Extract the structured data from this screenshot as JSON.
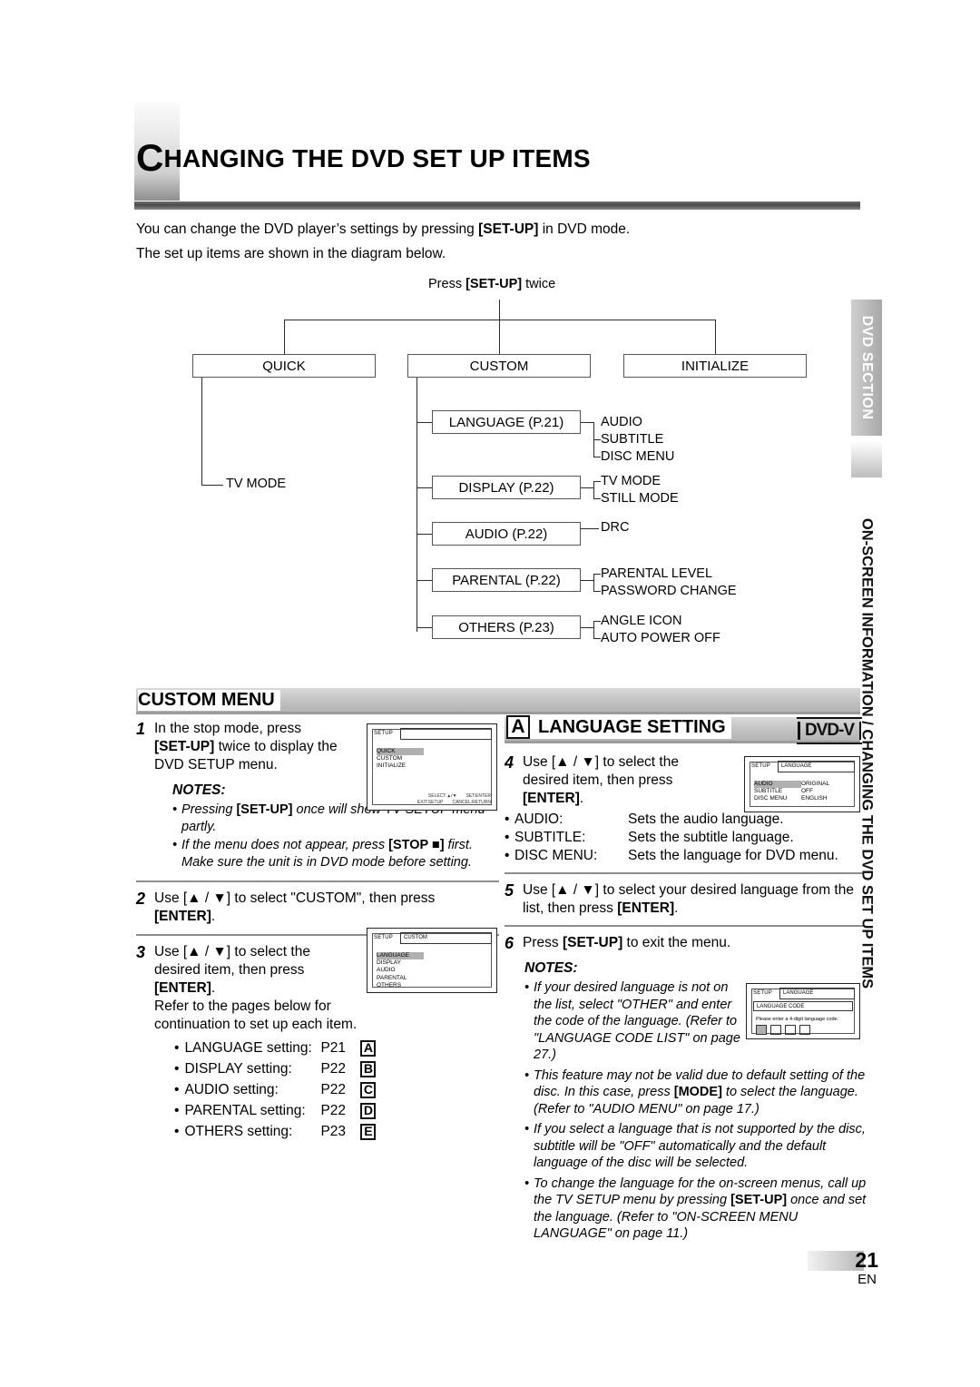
{
  "header": {
    "title_cap": "C",
    "title_rest": "HANGING THE DVD SET UP ITEMS",
    "intro_1_a": "You can change the DVD player’s settings by pressing ",
    "intro_1_b": "[SET-UP]",
    "intro_1_c": " in DVD mode.",
    "intro_2": "The set up items are shown in the diagram below."
  },
  "diagram": {
    "press_label_a": "Press ",
    "press_label_b": "[SET-UP]",
    "press_label_c": " twice",
    "top_boxes": [
      "QUICK",
      "CUSTOM",
      "INITIALIZE"
    ],
    "quick_children": [
      "TV MODE"
    ],
    "custom_boxes": [
      {
        "label": "LANGUAGE (P.21)",
        "children": [
          "AUDIO",
          "SUBTITLE",
          "DISC MENU"
        ]
      },
      {
        "label": "DISPLAY (P.22)",
        "children": [
          "TV MODE",
          "STILL MODE"
        ]
      },
      {
        "label": "AUDIO (P.22)",
        "children": [
          "DRC"
        ]
      },
      {
        "label": "PARENTAL (P.22)",
        "children": [
          "PARENTAL LEVEL",
          "PASSWORD CHANGE"
        ]
      },
      {
        "label": "OTHERS (P.23)",
        "children": [
          "ANGLE ICON",
          "AUTO POWER OFF"
        ]
      }
    ]
  },
  "custom_menu": {
    "heading": "CUSTOM MENU",
    "step1": {
      "num": "1",
      "line1": "In the stop mode, press",
      "bold1": "[SET-UP]",
      "line2": " twice to display the",
      "line3": "DVD SETUP menu.",
      "notes_heading": "NOTES:",
      "note1_a": "Pressing ",
      "note1_b": "[SET-UP]",
      "note1_c": " once will show TV SETUP menu partly.",
      "note2_a": "If the menu does not appear, press ",
      "note2_b": "[STOP ■]",
      "note2_c": " first. Make sure the unit is in DVD mode before setting."
    },
    "step2": {
      "num": "2",
      "text_a": "Use [▲ / ▼] to select \"CUSTOM\", then press ",
      "text_b": "[ENTER]",
      "text_c": "."
    },
    "step3": {
      "num": "3",
      "line1": "Use [▲ / ▼] to select the",
      "line2": "desired item, then press",
      "bold": "[ENTER]",
      "line3": ".",
      "line4": "Refer to the pages below for",
      "line5": "continuation to set up each item.",
      "refer_items": [
        {
          "name": "LANGUAGE setting:",
          "page": "P21",
          "badge": "A"
        },
        {
          "name": "DISPLAY setting:",
          "page": "P22",
          "badge": "B"
        },
        {
          "name": "AUDIO setting:",
          "page": "P22",
          "badge": "C"
        },
        {
          "name": "PARENTAL setting:",
          "page": "P22",
          "badge": "D"
        },
        {
          "name": "OTHERS setting:",
          "page": "P23",
          "badge": "E"
        }
      ]
    },
    "screen_setup": {
      "topbar_label": "SETUP",
      "topbar_value": "",
      "items": [
        "QUICK",
        "CUSTOM",
        "INITIALIZE"
      ],
      "selected": "QUICK",
      "foot_line1_left": "SELECT:▲/▼",
      "foot_line1_right": "SET:ENTER",
      "foot_line2_left": "EXIT:SETUP",
      "foot_line2_right": "CANCEL:RETURN"
    },
    "screen_custom": {
      "topbar_label": "SETUP",
      "topbar_value": "CUSTOM",
      "items": [
        "LANGUAGE",
        "DISPLAY",
        "AUDIO",
        "PARENTAL",
        "OTHERS"
      ],
      "selected": "LANGUAGE"
    }
  },
  "language_setting": {
    "badge": "A",
    "heading": "LANGUAGE SETTING",
    "logo": "DVD-V",
    "step4": {
      "num": "4",
      "line1": "Use [▲ / ▼] to select the",
      "line2": "desired item, then press",
      "bold": "[ENTER]",
      "line3": ".",
      "bullets": [
        {
          "k": "AUDIO:",
          "v": "Sets the audio language."
        },
        {
          "k": "SUBTITLE:",
          "v": "Sets the subtitle language."
        },
        {
          "k": "DISC MENU:",
          "v": "Sets the language for DVD menu."
        }
      ]
    },
    "step5": {
      "num": "5",
      "text_a": "Use [▲ / ▼] to select your desired language from the list, then press ",
      "text_b": "[ENTER]",
      "text_c": "."
    },
    "step6": {
      "num": "6",
      "text_a": "Press ",
      "text_b": "[SET-UP]",
      "text_c": " to exit the menu."
    },
    "notes_heading": "NOTES:",
    "notes": [
      {
        "parts": [
          {
            "t": "If your desired language is not on the list, select \"OTHER\" and enter the code of the language. (Refer to \"LANGUAGE CODE LIST\" on page 27.)",
            "b": false
          }
        ]
      },
      {
        "parts": [
          {
            "t": "This feature may not be valid due to default setting of the disc. In this case, press ",
            "b": false
          },
          {
            "t": "[MODE]",
            "b": true
          },
          {
            "t": " to select the language. (Refer to \"AUDIO MENU\" on page 17.)",
            "b": false
          }
        ]
      },
      {
        "parts": [
          {
            "t": "If you select a language that is not supported by the disc, subtitle will be \"OFF\" automatically and the default language of the disc will be selected.",
            "b": false
          }
        ]
      },
      {
        "parts": [
          {
            "t": "To change the language for the on-screen menus, call up the TV SETUP menu by pressing ",
            "b": false
          },
          {
            "t": "[SET-UP]",
            "b": true
          },
          {
            "t": " once and set the language. (Refer to \"ON-SCREEN MENU LANGUAGE\" on page 11.)",
            "b": false
          }
        ]
      }
    ],
    "screen_language": {
      "topbar_label": "SETUP",
      "topbar_value": "LANGUAGE",
      "rows": [
        {
          "k": "AUDIO",
          "v": "ORIGINAL",
          "sel": true
        },
        {
          "k": "SUBTITLE",
          "v": "OFF",
          "sel": false
        },
        {
          "k": "DISC MENU",
          "v": "ENGLISH",
          "sel": false
        }
      ]
    },
    "screen_langcode": {
      "topbar_label": "SETUP",
      "topbar_value": "LANGUAGE",
      "codebox_label": "LANGUAGE CODE",
      "prompt": "Please enter a 4-digit language code."
    }
  },
  "side": {
    "tab_label": "DVD SECTION",
    "running_head": "ON-SCREEN INFORMATION / CHANGING THE DVD SET UP ITEMS"
  },
  "footer": {
    "page_number": "21",
    "lang_code": "EN"
  }
}
